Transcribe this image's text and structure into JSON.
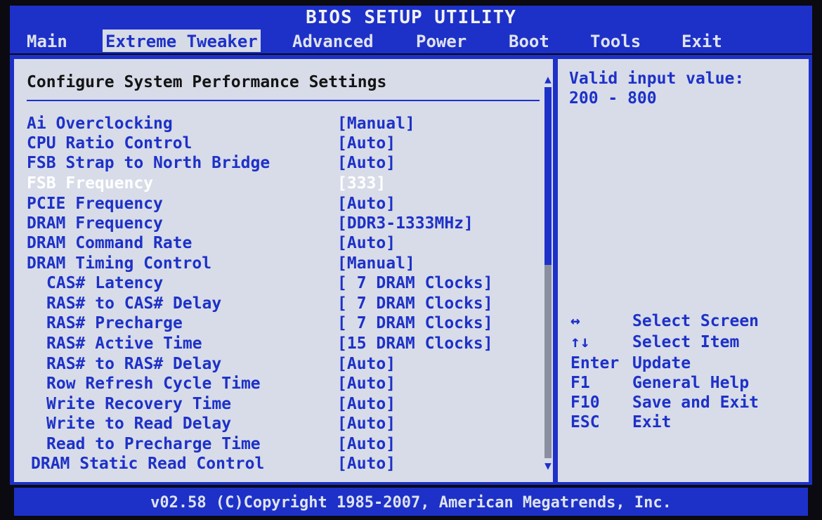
{
  "title": "BIOS SETUP UTILITY",
  "menu": {
    "tabs": [
      {
        "label": "Main"
      },
      {
        "label": "Extreme Tweaker"
      },
      {
        "label": "Advanced"
      },
      {
        "label": "Power"
      },
      {
        "label": "Boot"
      },
      {
        "label": "Tools"
      },
      {
        "label": "Exit"
      }
    ],
    "active_tab": "Extreme Tweaker"
  },
  "main": {
    "section_title": "Configure System Performance Settings",
    "selected_item": "FSB Frequency",
    "items": [
      {
        "label": "Ai Overclocking",
        "value": "[Manual]"
      },
      {
        "label": "CPU Ratio Control",
        "value": "[Auto]"
      },
      {
        "label": "FSB Strap to North Bridge",
        "value": "[Auto]"
      },
      {
        "label": "FSB Frequency",
        "value": "[333]"
      },
      {
        "label": "PCIE Frequency",
        "value": "[Auto]"
      },
      {
        "label": "DRAM Frequency",
        "value": "[DDR3-1333MHz]"
      },
      {
        "label": "DRAM Command Rate",
        "value": "[Auto]"
      },
      {
        "label": "DRAM Timing Control",
        "value": "[Manual]"
      },
      {
        "label": "CAS# Latency",
        "value": "[ 7 DRAM Clocks]"
      },
      {
        "label": "RAS# to CAS# Delay",
        "value": "[ 7 DRAM Clocks]"
      },
      {
        "label": "RAS# Precharge",
        "value": "[ 7 DRAM Clocks]"
      },
      {
        "label": "RAS# Active Time",
        "value": "[15 DRAM Clocks]"
      },
      {
        "label": "RAS# to RAS# Delay",
        "value": "[Auto]"
      },
      {
        "label": "Row Refresh Cycle Time",
        "value": "[Auto]"
      },
      {
        "label": "Write Recovery Time",
        "value": "[Auto]"
      },
      {
        "label": "Write to Read Delay",
        "value": "[Auto]"
      },
      {
        "label": "Read to Precharge Time",
        "value": "[Auto]"
      },
      {
        "label": "DRAM Static Read Control",
        "value": "[Auto]"
      }
    ],
    "scroll_position": 0.48
  },
  "help": {
    "line1": "Valid input value:",
    "line2": "200 - 800"
  },
  "keys": [
    {
      "key": "↔",
      "desc": "Select Screen"
    },
    {
      "key": "↑↓",
      "desc": "Select Item"
    },
    {
      "key": "Enter",
      "desc": "Update"
    },
    {
      "key": "F1",
      "desc": "General Help"
    },
    {
      "key": "F10",
      "desc": "Save and Exit"
    },
    {
      "key": "ESC",
      "desc": "Exit"
    }
  ],
  "footer": "v02.58 (C)Copyright 1985-2007, American Megatrends, Inc.",
  "colors": {
    "bios_blue": "#1d31c8",
    "panel_gray": "#d8dce8",
    "selected_text": "#ffffff"
  }
}
